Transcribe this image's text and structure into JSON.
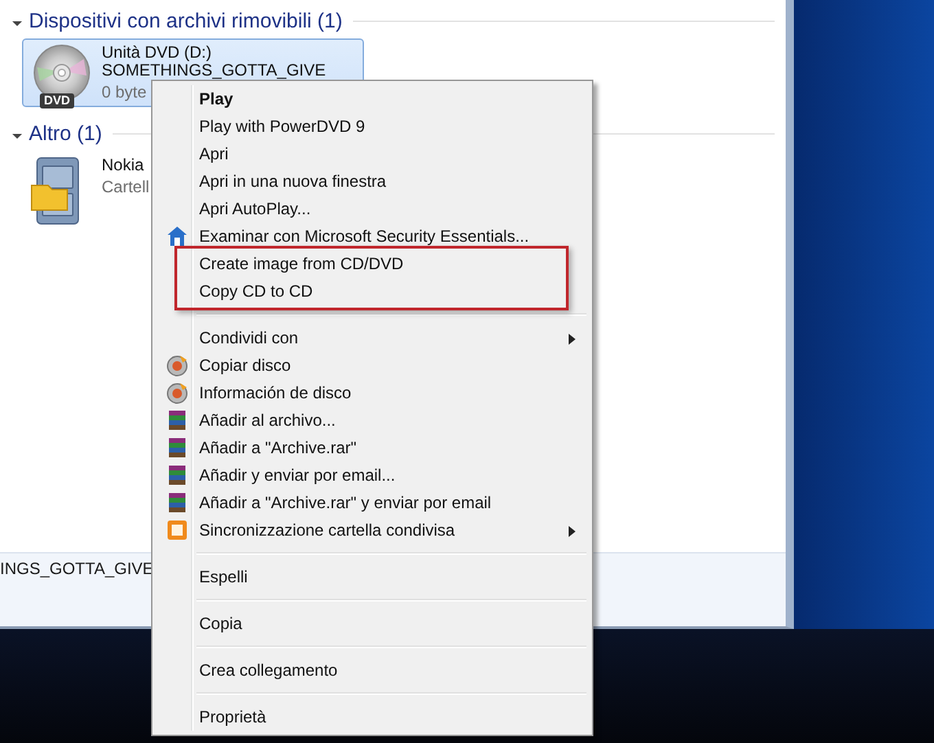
{
  "sections": [
    {
      "title": "Dispositivi con archivi rimovibili (1)",
      "expanded": true,
      "items": [
        {
          "kind": "dvd",
          "selected": true,
          "badge": "DVD",
          "lines": [
            "Unità DVD (D:)",
            "SOMETHINGS_GOTTA_GIVE",
            "0 byte"
          ]
        }
      ]
    },
    {
      "title": "Altro (1)",
      "expanded": true,
      "items": [
        {
          "kind": "folder",
          "selected": false,
          "lines": [
            "Nokia",
            "Cartell"
          ]
        }
      ]
    }
  ],
  "details_pane": {
    "text": "INGS_GOTTA_GIVE"
  },
  "context_menu": {
    "groups": [
      {
        "items": [
          {
            "label": "Play",
            "default": true,
            "kind": "plain",
            "submenu": false,
            "highlighted": false
          },
          {
            "label": "Play with PowerDVD 9",
            "default": false,
            "kind": "plain",
            "submenu": false,
            "highlighted": false
          },
          {
            "label": "Apri",
            "default": false,
            "kind": "plain",
            "submenu": false,
            "highlighted": false
          },
          {
            "label": "Apri in una nuova finestra",
            "default": false,
            "kind": "plain",
            "submenu": false,
            "highlighted": false
          },
          {
            "label": "Apri AutoPlay...",
            "default": false,
            "kind": "plain",
            "submenu": false,
            "highlighted": false
          },
          {
            "label": "Examinar con Microsoft Security Essentials...",
            "default": false,
            "kind": "scan",
            "submenu": false,
            "highlighted": false
          },
          {
            "label": "Create image from CD/DVD",
            "default": false,
            "kind": "plain",
            "submenu": false,
            "highlighted": true
          },
          {
            "label": "Copy CD to CD",
            "default": false,
            "kind": "plain",
            "submenu": false,
            "highlighted": true
          }
        ]
      },
      {
        "items": [
          {
            "label": "Condividi con",
            "default": false,
            "kind": "plain",
            "submenu": true,
            "highlighted": false
          },
          {
            "label": "Copiar disco",
            "default": false,
            "kind": "disc-tool",
            "submenu": false,
            "highlighted": false
          },
          {
            "label": "Información de disco",
            "default": false,
            "kind": "disc-tool",
            "submenu": false,
            "highlighted": false
          },
          {
            "label": "Añadir al archivo...",
            "default": false,
            "kind": "archive",
            "submenu": false,
            "highlighted": false
          },
          {
            "label": "Añadir a \"Archive.rar\"",
            "default": false,
            "kind": "archive",
            "submenu": false,
            "highlighted": false
          },
          {
            "label": "Añadir y enviar por email...",
            "default": false,
            "kind": "archive",
            "submenu": false,
            "highlighted": false
          },
          {
            "label": "Añadir a \"Archive.rar\" y enviar por email",
            "default": false,
            "kind": "archive",
            "submenu": false,
            "highlighted": false
          },
          {
            "label": "Sincronizzazione cartella condivisa",
            "default": false,
            "kind": "sync",
            "submenu": true,
            "highlighted": false
          }
        ]
      },
      {
        "items": [
          {
            "label": "Espelli",
            "default": false,
            "kind": "plain",
            "submenu": false,
            "highlighted": false
          }
        ]
      },
      {
        "items": [
          {
            "label": "Copia",
            "default": false,
            "kind": "plain",
            "submenu": false,
            "highlighted": false
          }
        ]
      },
      {
        "items": [
          {
            "label": "Crea collegamento",
            "default": false,
            "kind": "plain",
            "submenu": false,
            "highlighted": false
          }
        ]
      },
      {
        "items": [
          {
            "label": "Proprietà",
            "default": false,
            "kind": "plain",
            "submenu": false,
            "highlighted": false
          }
        ]
      }
    ]
  }
}
